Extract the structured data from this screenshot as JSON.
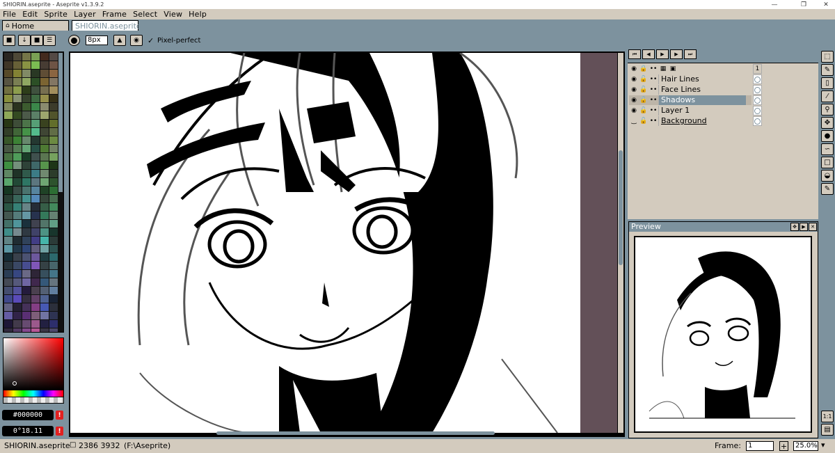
{
  "window": {
    "title": "SHIORIN.aseprite - Aseprite v1.3.9.2",
    "minimize": "—",
    "maximize": "❐",
    "close": "✕"
  },
  "menu": [
    "File",
    "Edit",
    "Sprite",
    "Layer",
    "Frame",
    "Select",
    "View",
    "Help"
  ],
  "tabs": [
    {
      "label": "Home",
      "icon": "home-icon",
      "active": false
    },
    {
      "label": "SHIORIN.aseprite",
      "active": true
    }
  ],
  "context_bar": {
    "brush_size": "8px",
    "pixel_perfect_label": "Pixel-perfect",
    "pixel_perfect_checked": true
  },
  "color": {
    "hex": "#000000",
    "hsv": "0°18.11",
    "accent": "#7d929e",
    "panel": "#d3cbbe",
    "canvas_bg": "#635058"
  },
  "timeline": {
    "controls": [
      "first-frame-icon",
      "prev-frame-icon",
      "play-icon",
      "next-frame-icon",
      "last-frame-icon"
    ],
    "frame_header": "1",
    "layers": [
      {
        "name": "Hair Lines",
        "visible": true,
        "selected": false
      },
      {
        "name": "Face Lines",
        "visible": true,
        "selected": false
      },
      {
        "name": "Shadows",
        "visible": true,
        "selected": true
      },
      {
        "name": "Layer 1",
        "visible": true,
        "selected": false
      },
      {
        "name": "Background",
        "visible": false,
        "selected": false
      }
    ]
  },
  "preview": {
    "title": "Preview"
  },
  "tools": [
    "marquee-icon",
    "pencil-icon",
    "eraser-icon",
    "eyedropper-icon",
    "zoom-icon",
    "move-icon",
    "bucket-icon",
    "curve-icon",
    "rectangle-icon",
    "contour-icon",
    "blur-icon",
    "pixel-ratio-icon",
    "timeline-toggle-icon"
  ],
  "status": {
    "filename": "SHIORIN.aseprite",
    "dimensions": "2386 3932",
    "path": "(F:\\Aseprite)",
    "frame_label": "Frame:",
    "frame_value": "1",
    "zoom": "25.0%",
    "plus": "+"
  }
}
